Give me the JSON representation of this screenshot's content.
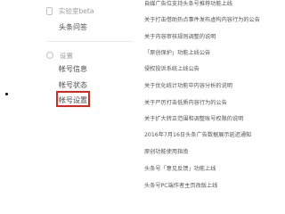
{
  "sidebar": {
    "lab_section": {
      "icon": "flask-icon",
      "label": "实验室beta",
      "items": [
        {
          "label": "头条问答"
        }
      ]
    },
    "settings_section": {
      "icon": "gear-icon",
      "label": "设置",
      "items": [
        {
          "label": "帐号信息"
        },
        {
          "label": "帐号状态"
        },
        {
          "label": "帐号设置"
        }
      ]
    },
    "highlight_color": "#e2231a"
  },
  "news": {
    "items": [
      "自媒广告位支持头条号推荐功能上线",
      "关于打击借助热点事件发布虚构内容行为的公告",
      "关于内容审核规则调整的说明",
      "「原创保护」功能上线公告",
      "侵权投诉系统上线公告",
      "关于优化统计功能中内容分析的说明",
      "关于严厉打击低质内容行为的公告",
      "关于扩大转正范围和调整账号权限的说明",
      "2016年7月16日头条广告数据展示延迟通知",
      "原创功能使用指南",
      "头条号「意见反馈」功能上线",
      "头条号PC端作者主页改版上线"
    ]
  }
}
